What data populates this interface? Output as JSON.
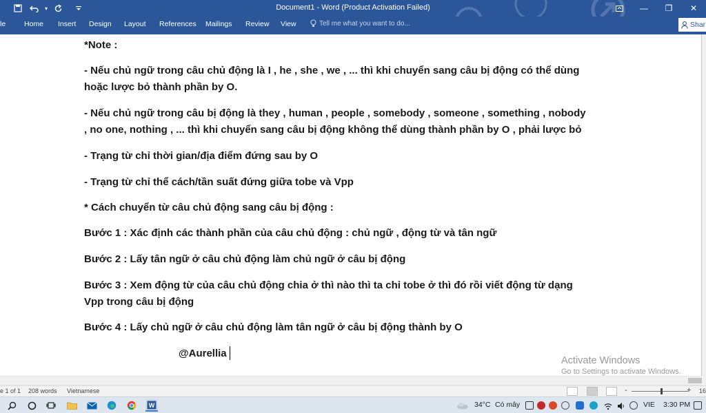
{
  "window": {
    "title": "Document1 - Word (Product Activation Failed)",
    "minimize": "—",
    "maximize": "❐",
    "close": "✕"
  },
  "ribbon": {
    "tabs": [
      "le",
      "Home",
      "Insert",
      "Design",
      "Layout",
      "References",
      "Mailings",
      "Review",
      "View"
    ],
    "tell_me_placeholder": "Tell me what you want to do...",
    "share_label": "Shar"
  },
  "document": {
    "paragraphs": [
      {
        "lines": [
          "*Note :"
        ]
      },
      {
        "lines": [
          "- Nếu chủ ngữ trong câu chủ động là I , he , she , we , ... thì khi chuyển sang câu bị động có thể dùng",
          "hoặc lược bỏ thành phần by O."
        ]
      },
      {
        "lines": [
          "-  Nếu chủ ngữ trong câu bị động là they , human , people , somebody , someone , something , nobody",
          ", no one, nothing , ... thì khi chuyển sang câu bị động không thể dùng thành phần by O , phải lược bỏ"
        ]
      },
      {
        "lines": [
          "- Trạng từ chỉ thời gian/địa điểm đứng sau by O"
        ]
      },
      {
        "lines": [
          "- Trạng từ chỉ thể cách/tần suất đứng giữa tobe và Vpp"
        ]
      },
      {
        "lines": [
          "* Cách chuyển từ câu chủ động sang câu bị động :"
        ]
      },
      {
        "lines": [
          "Bước 1 : Xác định các thành phần của câu chủ động : chủ ngữ , động từ và tân ngữ"
        ]
      },
      {
        "lines": [
          "Bước 2 : Lấy tân ngữ ở câu chủ động làm chủ ngữ ở câu bị động"
        ]
      },
      {
        "lines": [
          "Bước 3 : Xem động từ của câu chủ động chia ở thì nào thì ta chỉ tobe ở thì đó rồi viết động từ dạng",
          "Vpp trong câu bị động"
        ]
      },
      {
        "lines": [
          "Bước 4 : Lấy chủ ngữ ở câu chủ động làm tân ngữ ở câu bị động thành by O"
        ]
      }
    ],
    "signature": "@Aurellia"
  },
  "watermark": {
    "line1": "Activate Windows",
    "line2": "Go to Settings to activate Windows."
  },
  "statusbar": {
    "page": "e 1 of 1",
    "words": "208 words",
    "language": "Vietnamese",
    "zoom_minus": "-",
    "zoom_plus": "+",
    "zoom_value": "16"
  },
  "taskbar": {
    "temperature": "34°C",
    "weather": "Có mây",
    "language": "VIE",
    "time": "3:30 PM"
  },
  "colors": {
    "word_blue": "#2b579a",
    "page": "#ffffff",
    "canvas": "#e6e6e6",
    "taskbar": "#dde6ee"
  }
}
